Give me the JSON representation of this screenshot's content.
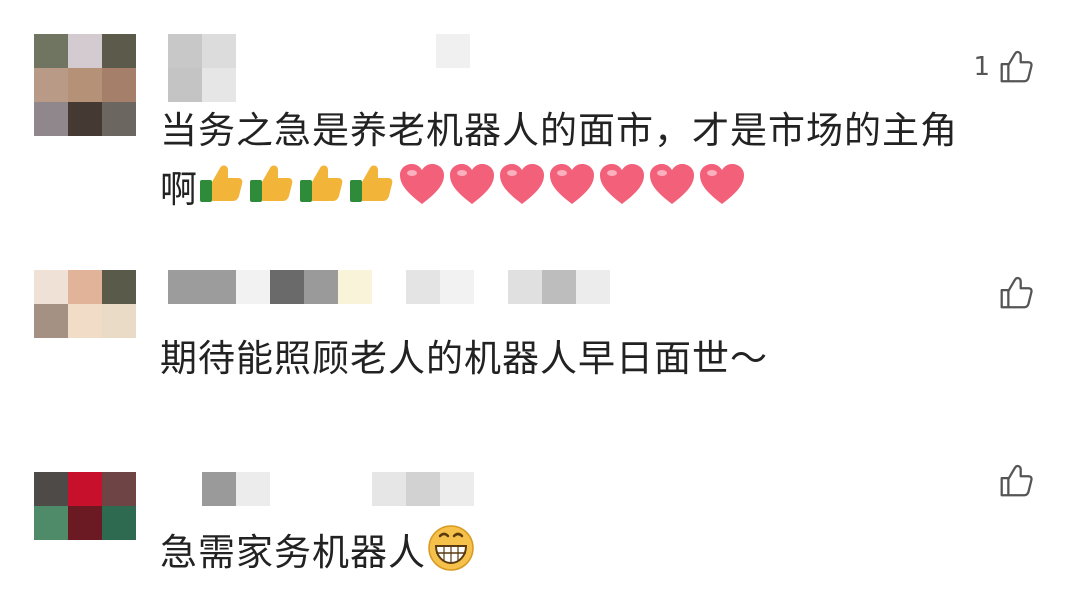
{
  "comments": [
    {
      "avatar_colors": [
        "#6f7561",
        "#d3cbcf",
        "#5c5a4a",
        "#b99a86",
        "#b59178",
        "#a67f6b",
        "#8f878b",
        "#453a33",
        "#6b6660"
      ],
      "name_blocks": [
        "#c8c8c8",
        "#dcdcdc",
        "#f0f0f0"
      ],
      "like_count": "1",
      "text_line1": "当务之急是养老机器人的面市，才是市场的主角",
      "text_line2": "啊",
      "emojis": [
        "thumbs-up",
        "thumbs-up",
        "thumbs-up",
        "thumbs-up",
        "heart",
        "heart",
        "heart",
        "heart",
        "heart",
        "heart",
        "heart"
      ]
    },
    {
      "avatar_colors": [
        "#efe1d6",
        "#e1b499",
        "#5a5a4a",
        "#a49184",
        "#f0dcc7",
        "#eadbc6"
      ],
      "name_blocks": [
        "#9c9c9c",
        "#dcdcdc",
        "#6a6a6a",
        "#9a9a9a",
        "#f8f3d9",
        "#e4e4e4",
        "#f2f2f2",
        "#e0e0e0",
        "#bdbdbd",
        "#ececec"
      ],
      "like_count": "",
      "text_line1": "期待能照顾老人的机器人早日面世～"
    },
    {
      "avatar_colors": [
        "#4d4a48",
        "#c7112c",
        "#6e4444",
        "#4f8a69",
        "#6b1922",
        "#2e6a50"
      ],
      "name_blocks": [
        "#9a9a9a",
        "#ececec",
        "#d2d2d2",
        "#e6e6e6"
      ],
      "like_count": "",
      "text_line1": "急需家务机器人",
      "emojis": [
        "grinning-face"
      ]
    }
  ],
  "colors": {
    "text": "#222222",
    "thumb": "#f2b53a",
    "cuff": "#2e8b3a",
    "heart": "#f2607a",
    "grin": "#f5c14a"
  }
}
